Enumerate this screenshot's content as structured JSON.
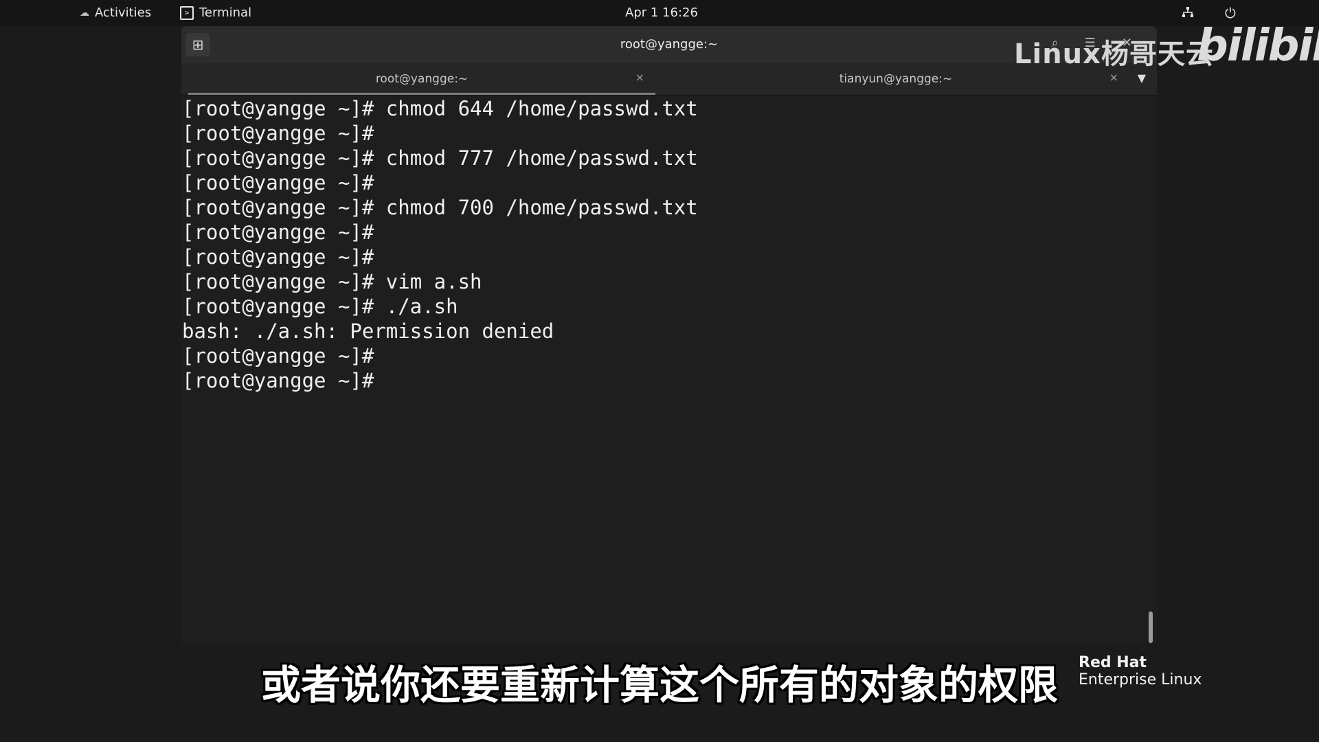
{
  "topbar": {
    "activities": "Activities",
    "app_name": "Terminal",
    "clock": "Apr 1  16:26",
    "network_icon": "network-icon",
    "power_icon": "power-icon"
  },
  "window": {
    "title": "root@yangge:~",
    "tabs": [
      {
        "label": "root@yangge:~",
        "close": "×"
      },
      {
        "label": "tianyun@yangge:~",
        "close": "×"
      }
    ],
    "tab_menu": "▼"
  },
  "terminal": {
    "lines": [
      "[root@yangge ~]# chmod 644 /home/passwd.txt",
      "[root@yangge ~]#",
      "[root@yangge ~]# chmod 777 /home/passwd.txt",
      "[root@yangge ~]#",
      "[root@yangge ~]# chmod 700 /home/passwd.txt",
      "[root@yangge ~]#",
      "[root@yangge ~]#",
      "[root@yangge ~]# vim a.sh",
      "[root@yangge ~]# ./a.sh",
      "bash: ./a.sh: Permission denied",
      "[root@yangge ~]#",
      "[root@yangge ~]#"
    ]
  },
  "overlay": {
    "watermark": "Linux杨哥天云",
    "bilibili": "bilibili",
    "subtitle": "或者说你还要重新计算这个所有的对象的权限",
    "redhat_brand": "Red Hat",
    "redhat_product": "Enterprise Linux"
  }
}
